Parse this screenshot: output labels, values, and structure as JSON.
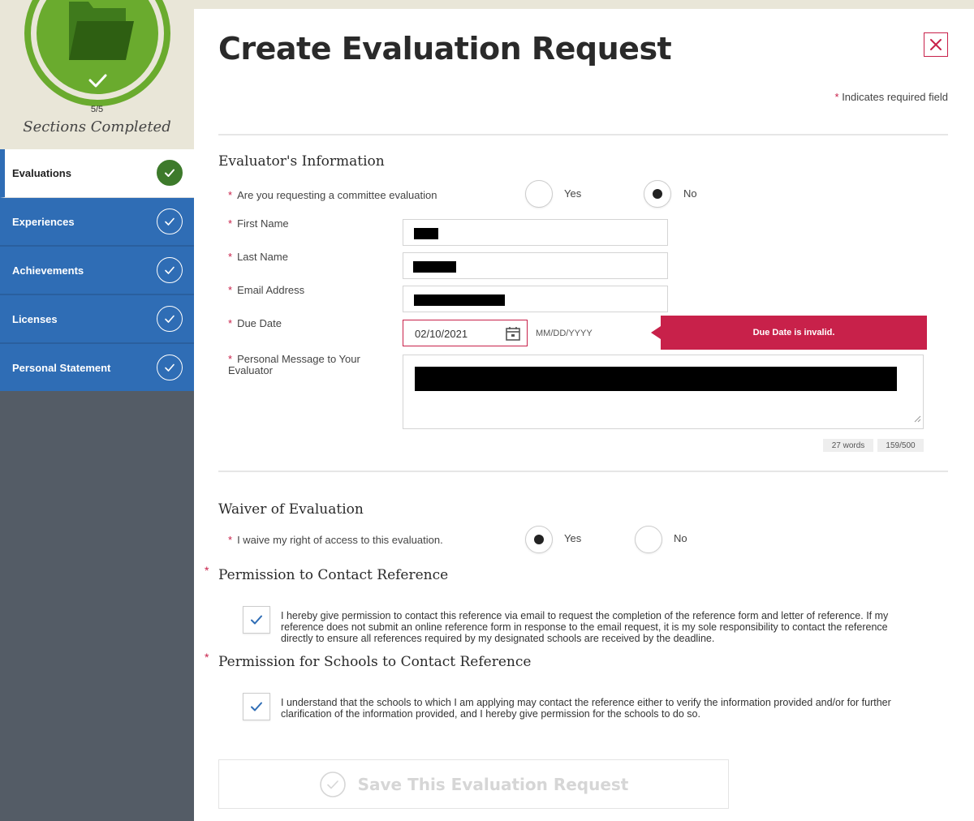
{
  "sidebar": {
    "progress_count": "5/5",
    "progress_label": "Sections Completed",
    "items": [
      {
        "label": "Evaluations",
        "active": true
      },
      {
        "label": "Experiences"
      },
      {
        "label": "Achievements"
      },
      {
        "label": "Licenses"
      },
      {
        "label": "Personal Statement"
      }
    ]
  },
  "header": {
    "title": "Create Evaluation Request",
    "required_note": "Indicates required field"
  },
  "evaluator": {
    "section_title": "Evaluator's Information",
    "committee_question": "Are you requesting a committee evaluation",
    "committee_options": [
      "Yes",
      "No"
    ],
    "committee_selected": "No",
    "first_name_label": "First Name",
    "last_name_label": "Last Name",
    "email_label": "Email Address",
    "due_date_label": "Due Date",
    "due_date_value": "02/10/2021",
    "due_date_hint": "MM/DD/YYYY",
    "due_date_error": "Due Date is invalid.",
    "message_label": "Personal Message to Your Evaluator",
    "word_count": "27 words",
    "char_count": "159/500"
  },
  "waiver": {
    "section_title": "Waiver of Evaluation",
    "question": "I waive my right of access to this evaluation.",
    "options": [
      "Yes",
      "No"
    ],
    "selected": "Yes"
  },
  "permission_contact": {
    "title": "Permission to Contact Reference",
    "text": "I hereby give permission to contact this reference via email to request the completion of the reference form and letter of reference. If my reference does not submit an online reference form in response to the email request, it is my sole responsibility to contact the reference directly to ensure all references required by my designated schools are received by the deadline.",
    "checked": true
  },
  "permission_schools": {
    "title": "Permission for Schools to Contact Reference",
    "text": "I understand that the schools to which I am applying may contact the reference either to verify the information provided and/or for further clarification of the information provided, and I hereby give permission for the schools to do so.",
    "checked": true
  },
  "save_button": {
    "label": "Save This Evaluation Request"
  },
  "colors": {
    "accent": "#c8214a",
    "nav_blue": "#2f6db5",
    "progress_green": "#6aab2e",
    "check_green": "#3d7a2b",
    "sidebar_dark": "#545c66"
  }
}
